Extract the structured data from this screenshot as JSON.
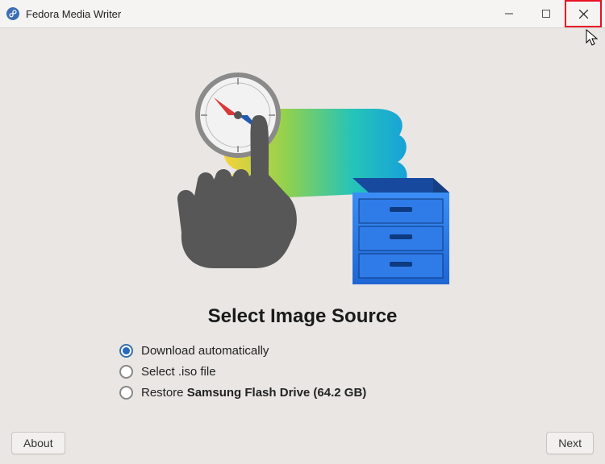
{
  "window": {
    "title": "Fedora Media Writer"
  },
  "icons": {
    "app": "fedora-icon",
    "minimize": "minimize-icon",
    "maximize": "maximize-icon",
    "close": "close-icon"
  },
  "page": {
    "heading": "Select Image Source"
  },
  "options": {
    "selected_index": 0,
    "items": [
      {
        "label_plain": "Download automatically",
        "label_bold": ""
      },
      {
        "label_plain": "Select .iso file",
        "label_bold": ""
      },
      {
        "label_plain": "Restore ",
        "label_bold": "Samsung Flash Drive (64.2 GB)"
      }
    ]
  },
  "footer": {
    "about_label": "About",
    "next_label": "Next"
  },
  "highlight": {
    "close_button": true
  }
}
